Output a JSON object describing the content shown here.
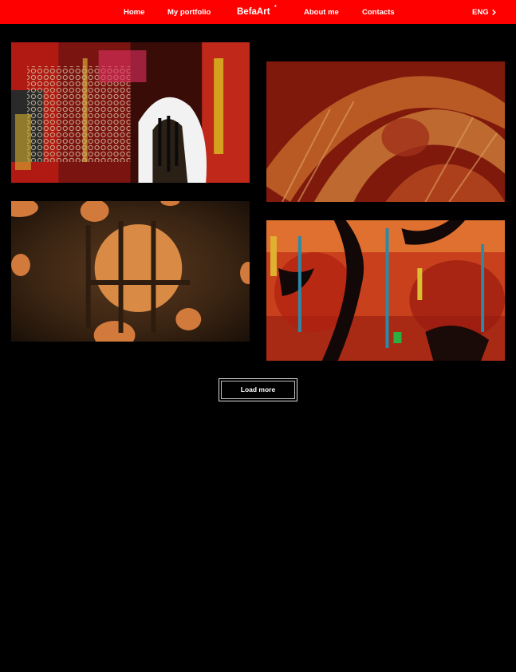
{
  "nav": {
    "home": "Home",
    "portfolio": "My portfolio",
    "logo": "BefaArt",
    "logo_mark": "*",
    "about": "About me",
    "contacts": "Contacts",
    "language": "ENG"
  },
  "gallery": {
    "load_more": "Load more"
  },
  "colors": {
    "header_bg": "#ff0000",
    "page_bg": "#000000",
    "text": "#ffffff"
  },
  "icons": {
    "language_arrow": "chevron-right-icon"
  }
}
